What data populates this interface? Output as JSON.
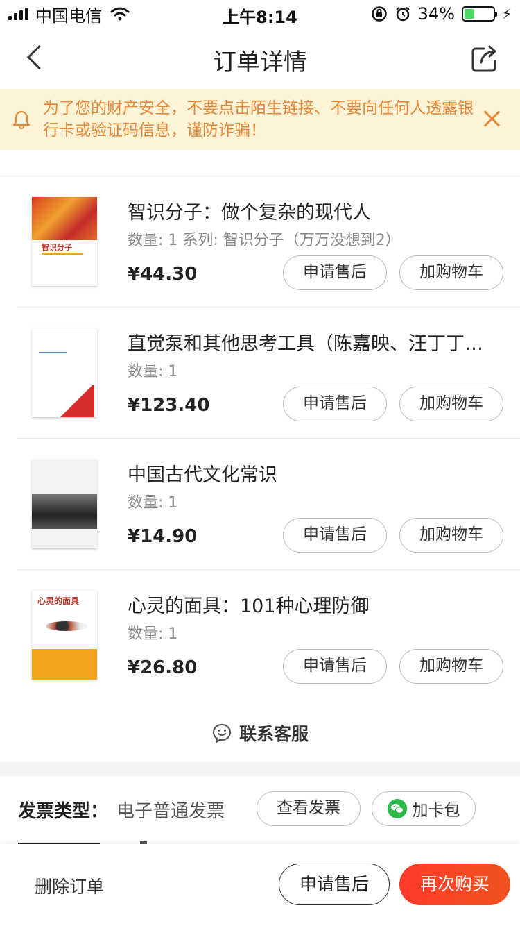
{
  "status_bar": {
    "carrier": "中国电信",
    "time": "上午8:14",
    "battery_percent": "34%",
    "battery_level": 0.34
  },
  "nav": {
    "title": "订单详情"
  },
  "notice": {
    "text": "为了您的财产安全，不要点击陌生链接、不要向任何人透露银行卡或验证码信息，谨防诈骗！"
  },
  "products": [
    {
      "title": "智识分子：做个复杂的现代人",
      "meta": "数量: 1 系列: 智识分子（万万没想到2）",
      "price": "¥44.30",
      "after_sale_label": "申请售后",
      "cart_label": "加购物车",
      "cover_text": "智识分子"
    },
    {
      "title": "直觉泵和其他思考工具（陈嘉映、汪丁丁、刘擎推荐）",
      "meta": "数量: 1",
      "price": "¥123.40",
      "after_sale_label": "申请售后",
      "cart_label": "加购物车"
    },
    {
      "title": "中国古代文化常识",
      "meta": "数量: 1",
      "price": "¥14.90",
      "after_sale_label": "申请售后",
      "cart_label": "加购物车"
    },
    {
      "title": "心灵的面具：101种心理防御",
      "meta": "数量: 1",
      "price": "¥26.80",
      "after_sale_label": "申请售后",
      "cart_label": "加购物车",
      "cover_text": "心灵的面具"
    }
  ],
  "contact": {
    "label": "联系客服"
  },
  "invoice": {
    "type_label": "发票类型：",
    "type_value": "电子普通发票",
    "view_label": "查看发票",
    "wallet_label": "加卡包"
  },
  "bottom_bar": {
    "delete_label": "删除订单",
    "after_sale_label": "申请售后",
    "rebuy_label": "再次购买"
  },
  "colors": {
    "notice_bg": "#fdf3d6",
    "notice_text": "#e8893a",
    "rebuy_bg": "#ff3a2a",
    "wechat_green": "#2cb94a"
  }
}
